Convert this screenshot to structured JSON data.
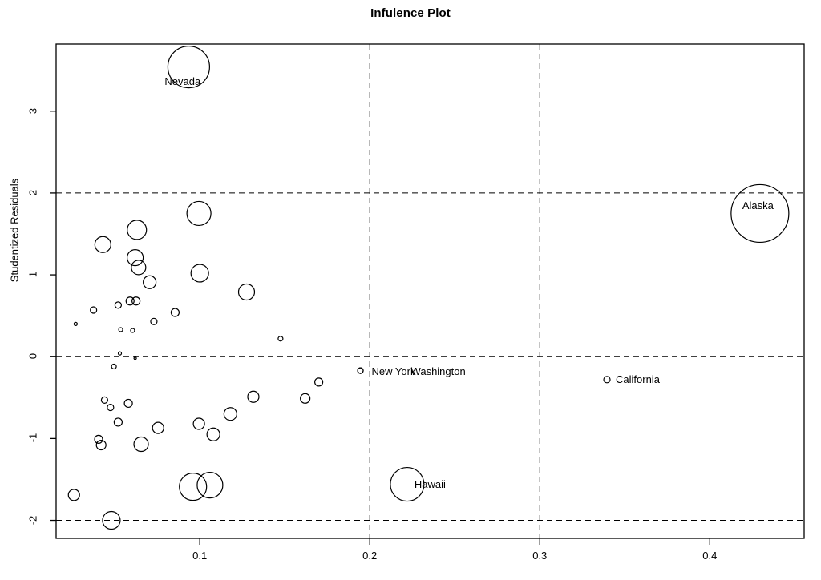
{
  "chart_data": {
    "type": "scatter",
    "title": "Infulence Plot",
    "xlabel": "",
    "ylabel": "Studentized Residuals",
    "xlim": [
      0.0155,
      0.4555
    ],
    "ylim": [
      -2.22,
      3.82
    ],
    "grid": false,
    "legend": null,
    "x_ticks": [
      {
        "value": 0.1,
        "label": "0.1"
      },
      {
        "value": 0.2,
        "label": "0.2"
      },
      {
        "value": 0.3,
        "label": "0.3"
      },
      {
        "value": 0.4,
        "label": "0.4"
      }
    ],
    "y_ticks": [
      {
        "value": 3,
        "label": "3"
      },
      {
        "value": 2,
        "label": "2"
      },
      {
        "value": 1,
        "label": "1"
      },
      {
        "value": 0,
        "label": "0"
      },
      {
        "value": -1,
        "label": "-1"
      },
      {
        "value": -2,
        "label": "-2"
      }
    ],
    "reference_lines": {
      "horizontal": [
        {
          "value": 2,
          "style": "dashed"
        },
        {
          "value": 0,
          "style": "dashed"
        },
        {
          "value": -2,
          "style": "dashed"
        }
      ],
      "vertical": [
        {
          "value": 0.2,
          "style": "dashed"
        },
        {
          "value": 0.3,
          "style": "dashed"
        }
      ]
    },
    "marker": {
      "shape": "circle",
      "fill": "none",
      "stroke": "#000000",
      "size_encodes": "cooks-distance"
    },
    "points": [
      {
        "label": "Nevada",
        "x": 0.0935,
        "y": 3.54,
        "r": 26
      },
      {
        "label": "Alaska",
        "x": 0.4295,
        "y": 1.75,
        "r": 36
      },
      {
        "label": "Hawaii",
        "x": 0.222,
        "y": -1.56,
        "r": 21
      },
      {
        "label": "New York",
        "x": 0.1945,
        "y": -0.17,
        "r": 3.5
      },
      {
        "label": "Washington",
        "x": 0.1945,
        "y": -0.17,
        "r": 3.5
      },
      {
        "label": "California",
        "x": 0.3395,
        "y": -0.28,
        "r": 4
      },
      {
        "label": "",
        "x": 0.0995,
        "y": 1.75,
        "r": 15
      },
      {
        "label": "",
        "x": 0.063,
        "y": 1.55,
        "r": 12
      },
      {
        "label": "",
        "x": 0.043,
        "y": 1.37,
        "r": 10
      },
      {
        "label": "",
        "x": 0.062,
        "y": 1.21,
        "r": 10
      },
      {
        "label": "",
        "x": 0.064,
        "y": 1.09,
        "r": 9
      },
      {
        "label": "",
        "x": 0.1,
        "y": 1.02,
        "r": 11
      },
      {
        "label": "",
        "x": 0.0705,
        "y": 0.91,
        "r": 8
      },
      {
        "label": "",
        "x": 0.1275,
        "y": 0.79,
        "r": 10
      },
      {
        "label": "",
        "x": 0.059,
        "y": 0.68,
        "r": 5
      },
      {
        "label": "",
        "x": 0.0625,
        "y": 0.68,
        "r": 5
      },
      {
        "label": "",
        "x": 0.052,
        "y": 0.63,
        "r": 4
      },
      {
        "label": "",
        "x": 0.0375,
        "y": 0.57,
        "r": 4
      },
      {
        "label": "",
        "x": 0.0855,
        "y": 0.54,
        "r": 5
      },
      {
        "label": "",
        "x": 0.027,
        "y": 0.4,
        "r": 2
      },
      {
        "label": "",
        "x": 0.073,
        "y": 0.43,
        "r": 4
      },
      {
        "label": "",
        "x": 0.0535,
        "y": 0.33,
        "r": 2.5
      },
      {
        "label": "",
        "x": 0.0605,
        "y": 0.32,
        "r": 2.5
      },
      {
        "label": "",
        "x": 0.1475,
        "y": 0.22,
        "r": 3
      },
      {
        "label": "",
        "x": 0.053,
        "y": 0.04,
        "r": 2
      },
      {
        "label": "",
        "x": 0.062,
        "y": -0.02,
        "r": 1.5
      },
      {
        "label": "",
        "x": 0.0495,
        "y": -0.12,
        "r": 3
      },
      {
        "label": "",
        "x": 0.17,
        "y": -0.31,
        "r": 5
      },
      {
        "label": "",
        "x": 0.162,
        "y": -0.51,
        "r": 6
      },
      {
        "label": "",
        "x": 0.1315,
        "y": -0.49,
        "r": 7
      },
      {
        "label": "",
        "x": 0.044,
        "y": -0.53,
        "r": 4
      },
      {
        "label": "",
        "x": 0.058,
        "y": -0.57,
        "r": 5
      },
      {
        "label": "",
        "x": 0.0475,
        "y": -0.62,
        "r": 4
      },
      {
        "label": "",
        "x": 0.118,
        "y": -0.7,
        "r": 8
      },
      {
        "label": "",
        "x": 0.052,
        "y": -0.8,
        "r": 5
      },
      {
        "label": "",
        "x": 0.0995,
        "y": -0.82,
        "r": 7
      },
      {
        "label": "",
        "x": 0.108,
        "y": -0.95,
        "r": 8
      },
      {
        "label": "",
        "x": 0.0755,
        "y": -0.87,
        "r": 7
      },
      {
        "label": "",
        "x": 0.0405,
        "y": -1.01,
        "r": 5
      },
      {
        "label": "",
        "x": 0.042,
        "y": -1.08,
        "r": 6
      },
      {
        "label": "",
        "x": 0.0655,
        "y": -1.07,
        "r": 9
      },
      {
        "label": "",
        "x": 0.026,
        "y": -1.69,
        "r": 7
      },
      {
        "label": "",
        "x": 0.096,
        "y": -1.59,
        "r": 17
      },
      {
        "label": "",
        "x": 0.106,
        "y": -1.57,
        "r": 16
      },
      {
        "label": "",
        "x": 0.048,
        "y": -2.0,
        "r": 11
      }
    ]
  },
  "axis": {
    "box": {
      "left": 70,
      "top": 55,
      "right": 1003,
      "bottom": 672
    }
  },
  "labels": {
    "nevada": "Nevada",
    "alaska": "Alaska",
    "hawaii": "Hawaii",
    "new_york": "New York",
    "washington": "Washington",
    "california": "California"
  }
}
